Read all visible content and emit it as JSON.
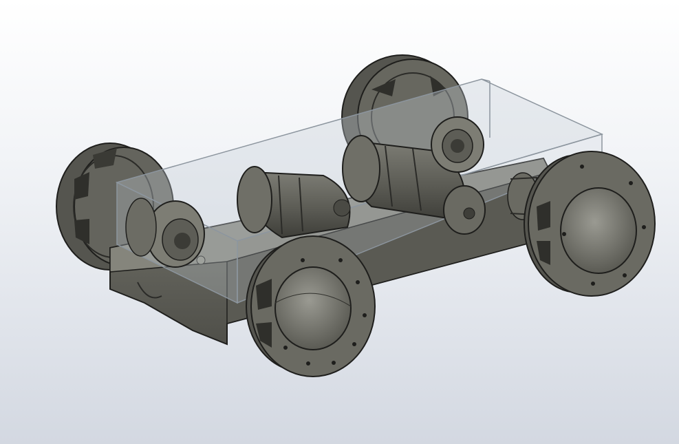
{
  "scene": {
    "subject": "chassis-model",
    "background": {
      "top": "#ffffff",
      "bottom": "#d3d8e1"
    },
    "colors": {
      "metal": "#6e6e66",
      "metal_dark": "#3f3f3a",
      "metal_light": "#9b9b92",
      "edge": "#1e1e1c",
      "glass_fill": "#c7cfd6",
      "glass_edge": "#8c959e"
    },
    "parts": {
      "wheels": 4,
      "motors": 2
    }
  }
}
